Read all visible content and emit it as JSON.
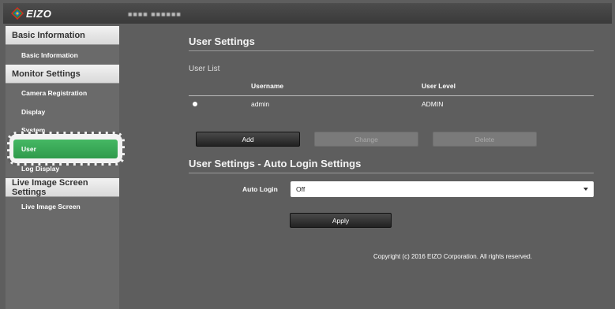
{
  "header": {
    "logo_text": "EIZO",
    "device_name": "■■■■ ■■■■■■"
  },
  "sidebar": {
    "sections": [
      {
        "label": "Basic Information",
        "items": [
          "Basic Information"
        ]
      },
      {
        "label": "Monitor Settings",
        "items": [
          "Camera Registration",
          "Display",
          "System",
          "User",
          "Log Display"
        ]
      },
      {
        "label": "Live Image Screen Settings",
        "items": [
          "Live Image Screen"
        ]
      }
    ],
    "active_item": "User"
  },
  "main": {
    "user_settings_title": "User Settings",
    "user_list_label": "User List",
    "table": {
      "headers": [
        "Username",
        "User Level"
      ],
      "rows": [
        {
          "username": "admin",
          "level": "ADMIN"
        }
      ]
    },
    "buttons": {
      "add": "Add",
      "change": "Change",
      "delete": "Delete"
    },
    "auto_login_title": "User Settings - Auto Login Settings",
    "auto_login_label": "Auto Login",
    "auto_login_value": "Off",
    "apply": "Apply",
    "copyright": "Copyright (c) 2016 EIZO Corporation. All rights reserved."
  },
  "colors": {
    "background": "#5e5e5e",
    "sidebar": "#6a6a6a",
    "active_item": "#3aa856",
    "header": "#3f3f3f"
  },
  "icons": [
    "eizo-logo-icon",
    "radio-icon",
    "chevron-down-icon"
  ]
}
